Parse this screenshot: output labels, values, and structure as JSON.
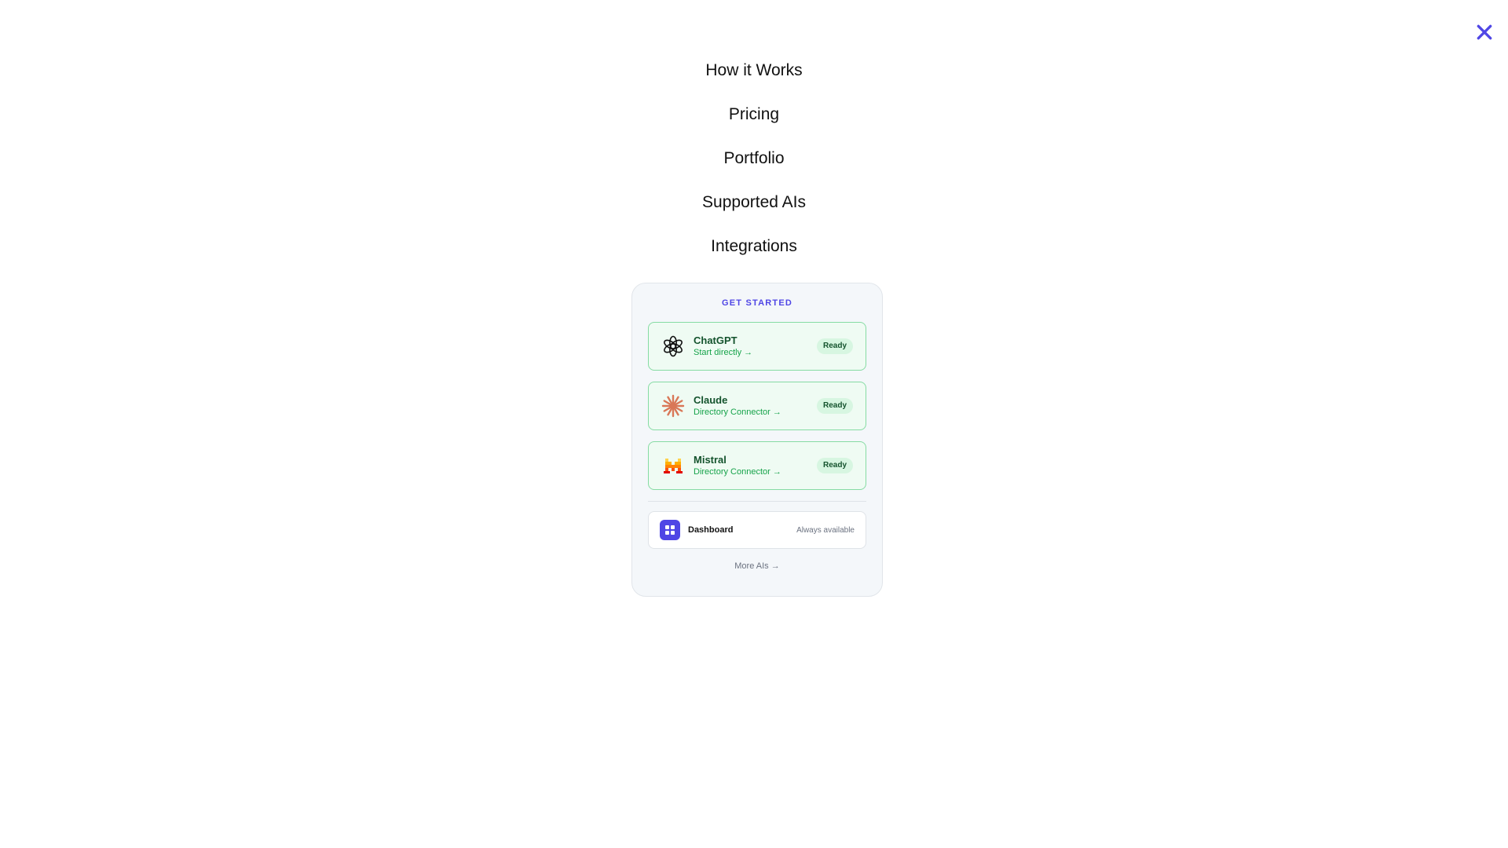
{
  "close_icon": "close-icon",
  "colors": {
    "accent": "#4f46e5",
    "ready_bg": "#effbf3",
    "ready_border": "#86dba3",
    "ready_text": "#16a34a"
  },
  "nav": {
    "items": [
      {
        "label": "How it Works"
      },
      {
        "label": "Pricing"
      },
      {
        "label": "Portfolio"
      },
      {
        "label": "Supported AIs"
      },
      {
        "label": "Integrations"
      }
    ]
  },
  "panel": {
    "heading": "GET STARTED",
    "ais": [
      {
        "name": "ChatGPT",
        "sub": "Start directly →",
        "badge": "Ready",
        "icon": "openai-logo-icon"
      },
      {
        "name": "Claude",
        "sub": "Directory Connector →",
        "badge": "Ready",
        "icon": "claude-logo-icon"
      },
      {
        "name": "Mistral",
        "sub": "Directory Connector →",
        "badge": "Ready",
        "icon": "mistral-logo-icon"
      }
    ],
    "dashboard": {
      "label": "Dashboard",
      "note": "Always available",
      "icon": "grid-icon"
    },
    "more_link": "More AIs →"
  }
}
